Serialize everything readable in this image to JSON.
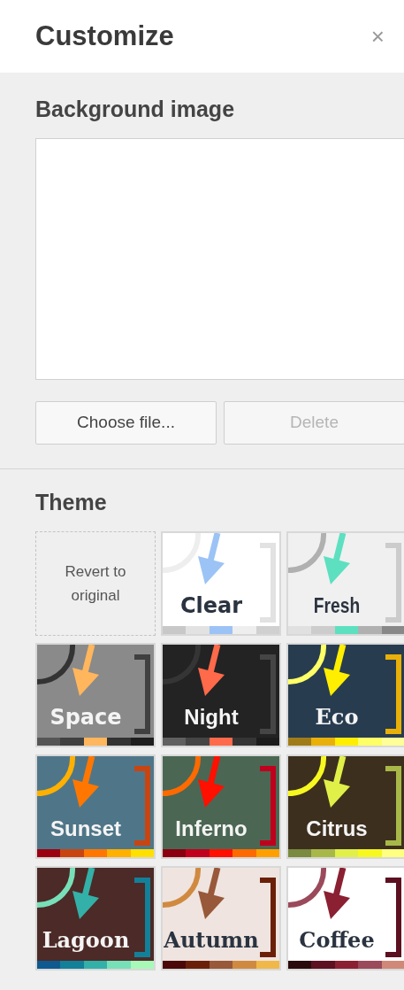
{
  "header": {
    "title": "Customize",
    "close": "×"
  },
  "background_image": {
    "heading": "Background image",
    "buttons": [
      {
        "label": "Choose file...",
        "disabled": false
      },
      {
        "label": "Delete",
        "disabled": true
      }
    ]
  },
  "theme": {
    "heading": "Theme",
    "tiles": [
      {
        "kind": "revert",
        "label": "Revert to original"
      },
      {
        "kind": "serif_sans",
        "name": "Clear",
        "color": "#ffffff",
        "swatches": [
          {
            "color": "#c8c8c8"
          },
          {
            "color": "#e2e2e2"
          },
          {
            "color": "#9cc3f5"
          },
          {
            "color": "#eeeeee"
          },
          {
            "color": "#d0d0d0"
          }
        ]
      },
      {
        "kind": "condensed",
        "name": "Fresh",
        "color": "#f0f0f0",
        "swatches": [
          {
            "color": "#e0e0e0"
          },
          {
            "color": "#cccccc"
          },
          {
            "color": "#5de0c0"
          },
          {
            "color": "#b0b0b0"
          },
          {
            "color": "#888888"
          }
        ]
      },
      {
        "kind": "serif_sans",
        "name": "Space",
        "color": "#8a8a8a",
        "swatches": [
          {
            "color": "#555555"
          },
          {
            "color": "#404040"
          },
          {
            "color": "#ffb65c"
          },
          {
            "color": "#333333"
          },
          {
            "color": "#1e1e1e"
          }
        ]
      },
      {
        "kind": "sans",
        "name": "Night",
        "color": "#232323",
        "swatches": [
          {
            "color": "#606060"
          },
          {
            "color": "#454545"
          },
          {
            "color": "#ff6a4a"
          },
          {
            "color": "#353535"
          },
          {
            "color": "#1c1c1c"
          }
        ]
      },
      {
        "kind": "serif",
        "name": "Eco",
        "color": "#283c50",
        "swatches": [
          {
            "color": "#a07c18"
          },
          {
            "color": "#e8b008"
          },
          {
            "color": "#ffee00"
          },
          {
            "color": "#ffff66"
          },
          {
            "color": "#ffff99"
          }
        ]
      },
      {
        "kind": "sans",
        "name": "Sunset",
        "color": "#4f7688",
        "swatches": [
          {
            "color": "#9a0010"
          },
          {
            "color": "#c84512"
          },
          {
            "color": "#ff7700"
          },
          {
            "color": "#ffb000"
          },
          {
            "color": "#ffe000"
          }
        ]
      },
      {
        "kind": "sans",
        "name": "Inferno",
        "color": "#4b6753",
        "swatches": [
          {
            "color": "#8a0010"
          },
          {
            "color": "#c0001c"
          },
          {
            "color": "#ff1000"
          },
          {
            "color": "#ff6a00"
          },
          {
            "color": "#ffa000"
          }
        ]
      },
      {
        "kind": "sans",
        "name": "Citrus",
        "color": "#3d2f1e",
        "swatches": [
          {
            "color": "#7a8a40"
          },
          {
            "color": "#a8b848"
          },
          {
            "color": "#e0f048"
          },
          {
            "color": "#f6f820"
          },
          {
            "color": "#ffff80"
          }
        ]
      },
      {
        "kind": "serif",
        "name": "Lagoon",
        "color": "#4c2a27",
        "swatches": [
          {
            "color": "#0e5a90"
          },
          {
            "color": "#13809a"
          },
          {
            "color": "#33b0a8"
          },
          {
            "color": "#78e0b8"
          },
          {
            "color": "#a8f8b8"
          }
        ]
      },
      {
        "kind": "serif",
        "name": "Autumn",
        "color": "#efe4df",
        "swatches": [
          {
            "color": "#4a0808"
          },
          {
            "color": "#6a2008"
          },
          {
            "color": "#98583a"
          },
          {
            "color": "#d08a40"
          },
          {
            "color": "#f0b848"
          }
        ]
      },
      {
        "kind": "serif",
        "name": "Coffee",
        "color": "#ffffff",
        "swatches": [
          {
            "color": "#2a0a0a"
          },
          {
            "color": "#5c1020"
          },
          {
            "color": "#8a2032"
          },
          {
            "color": "#9a4a5a"
          },
          {
            "color": "#d08878"
          }
        ]
      }
    ]
  }
}
